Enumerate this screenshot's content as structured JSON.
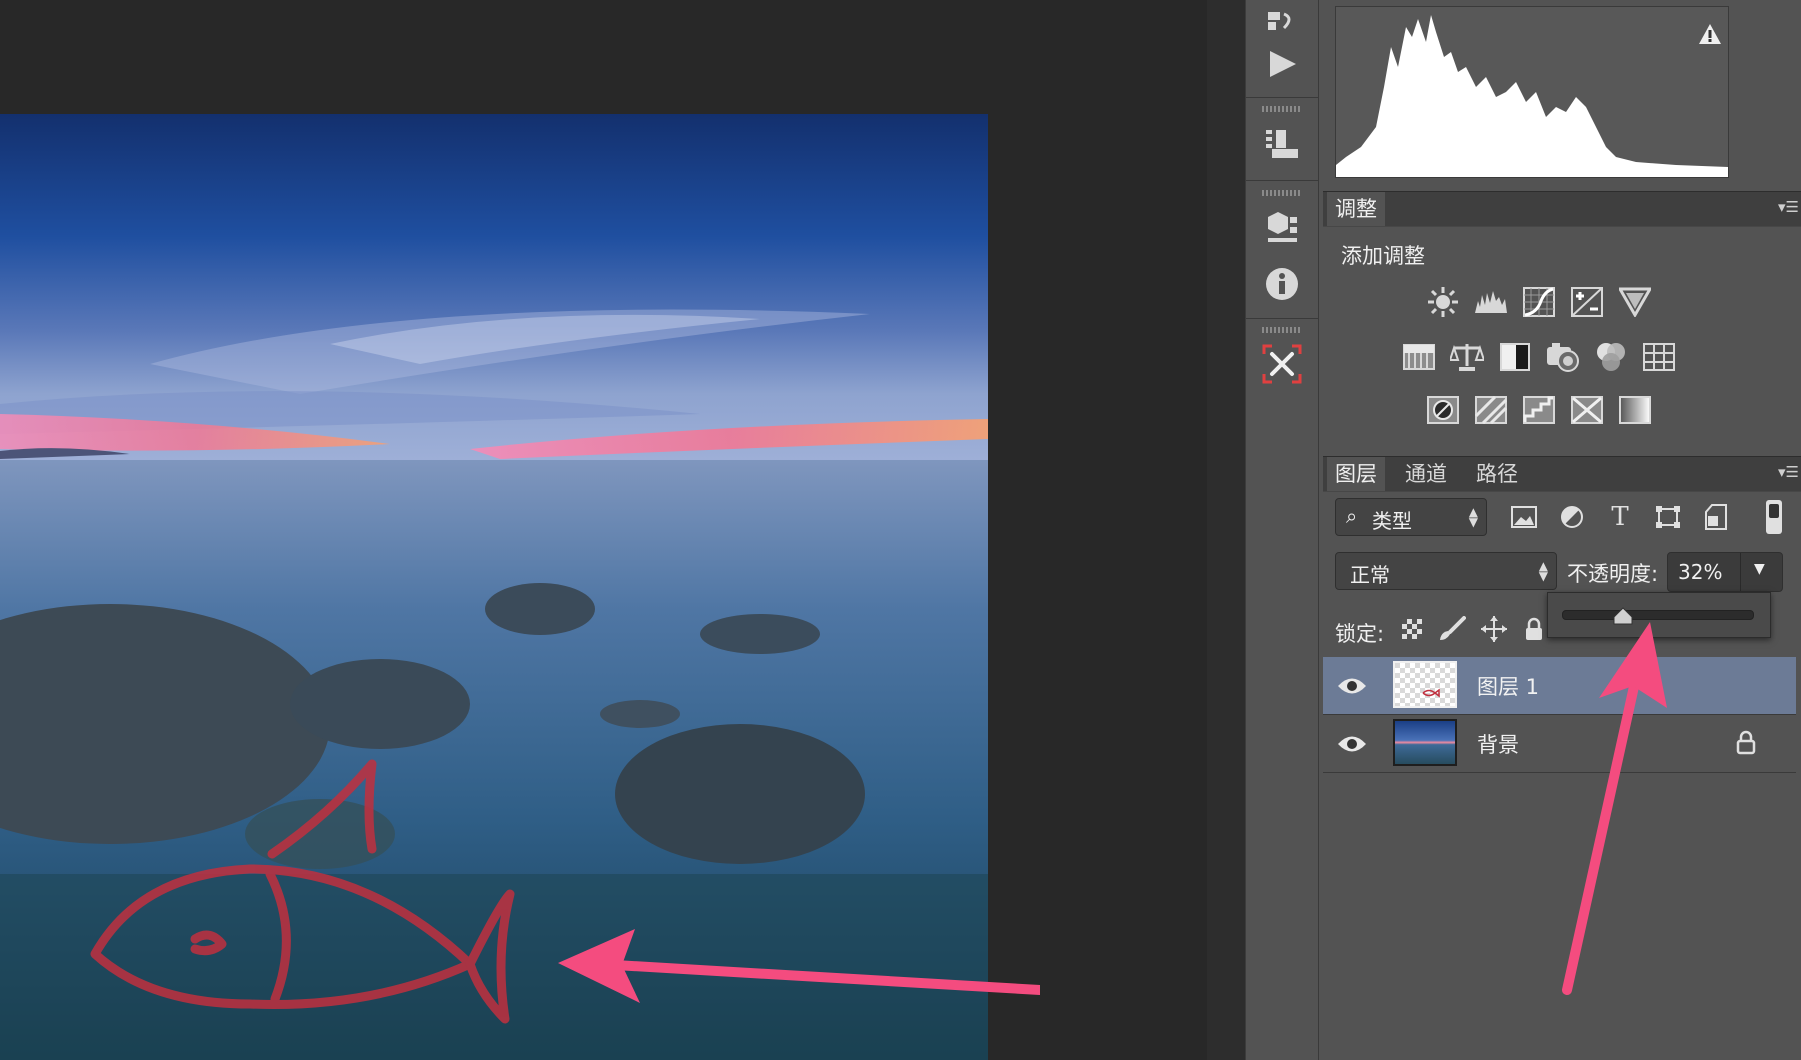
{
  "adjustments": {
    "tab": "调整",
    "title": "添加调整",
    "icons_row1": [
      "brightness-contrast-icon",
      "levels-icon",
      "curves-icon",
      "exposure-icon",
      "vibrance-icon"
    ],
    "icons_row2": [
      "hue-saturation-icon",
      "color-balance-icon",
      "black-white-icon",
      "photo-filter-icon",
      "channel-mixer-icon",
      "color-lookup-icon"
    ],
    "icons_row3": [
      "invert-icon",
      "posterize-icon",
      "threshold-icon",
      "selective-color-icon",
      "gradient-map-icon"
    ]
  },
  "layers_panel": {
    "tabs": [
      "图层",
      "通道",
      "路径"
    ],
    "filter_label": "类型",
    "blend_mode": "正常",
    "opacity_label": "不透明度:",
    "opacity_value": "32%",
    "opacity_level": 0.32,
    "lock_label": "锁定:",
    "layers": [
      {
        "name": "图层 1",
        "selected": true,
        "visible": true,
        "locked": false
      },
      {
        "name": "背景",
        "selected": false,
        "visible": true,
        "locked": true
      }
    ]
  },
  "colors": {
    "panel_bg": "#535353",
    "selected_layer": "#6c7b96",
    "annotation_arrow": "#f44c7f",
    "drawing_stroke": "#c0303f"
  }
}
